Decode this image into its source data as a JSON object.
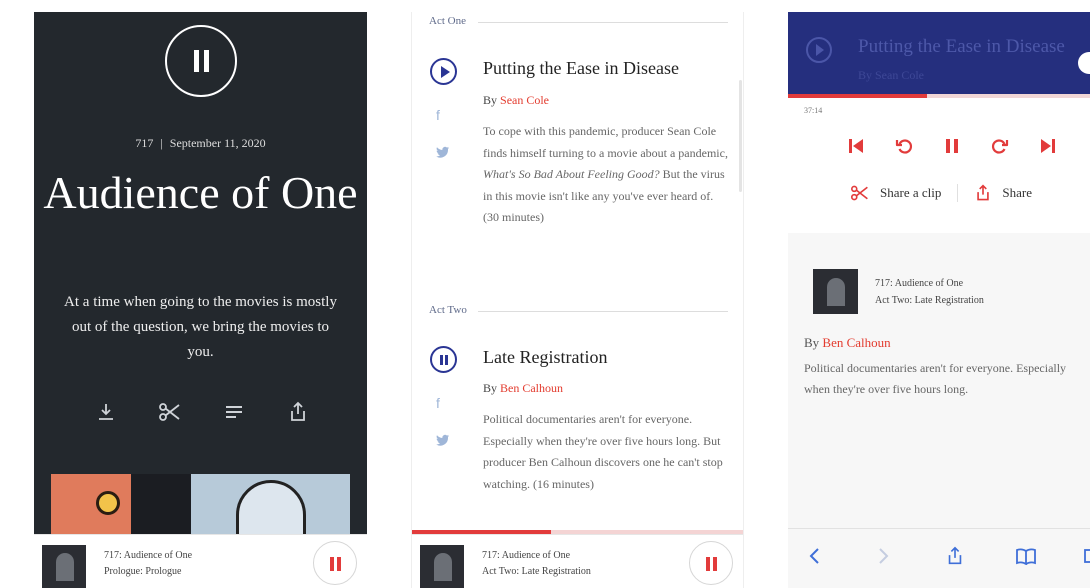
{
  "screen1": {
    "episode_number": "717",
    "separator": "|",
    "date": "September 11, 2020",
    "title": "Audience of One",
    "description": "At a time when going to the movies is mostly out of the question, we bring the movies to you.",
    "tools": [
      "download-icon",
      "scissors-icon",
      "transcript-icon",
      "share-icon"
    ],
    "mini_player": {
      "line1": "717: Audience of One",
      "line2": "Prologue: Prologue"
    }
  },
  "screen2": {
    "act_one": {
      "label": "Act One",
      "title": "Putting the Ease in Disease",
      "by_prefix": "By",
      "author": "Sean Cole",
      "description_1": "To cope with this pandemic, producer Sean Cole finds himself turning to a movie about a pandemic, ",
      "description_italic": "What's So Bad About Feeling Good?",
      "description_2": " But the virus in this movie isn't like any you've ever heard of. (30 minutes)"
    },
    "act_two": {
      "label": "Act Two",
      "title": "Late Registration",
      "by_prefix": "By",
      "author": "Ben Calhoun",
      "description": "Political documentaries aren't for everyone. Especially when they're over five hours long. But producer Ben Calhoun discovers one he can't stop watching. (16 minutes)"
    },
    "social": {
      "facebook": "f",
      "twitter": "t"
    },
    "progress": 0.42,
    "mini_player": {
      "line1": "717: Audience of One",
      "line2": "Act Two: Late Registration"
    }
  },
  "screen3": {
    "header_title": "Putting the Ease in Disease",
    "header_by": "By Sean Cole",
    "progress": 0.46,
    "time_elapsed": "37:14",
    "share_clip_label": "Share a clip",
    "share_label": "Share",
    "episode_line1": "717: Audience of One",
    "episode_line2": "Act Two: Late Registration",
    "by_prefix": "By",
    "author": "Ben Calhoun",
    "description": "Political documentaries aren't for everyone. Especially when they're over five hours long."
  },
  "colors": {
    "accent_red": "#e23b3b",
    "navy": "#252f7e",
    "dark_bg": "#23282d",
    "link_blue": "#2a3594"
  }
}
